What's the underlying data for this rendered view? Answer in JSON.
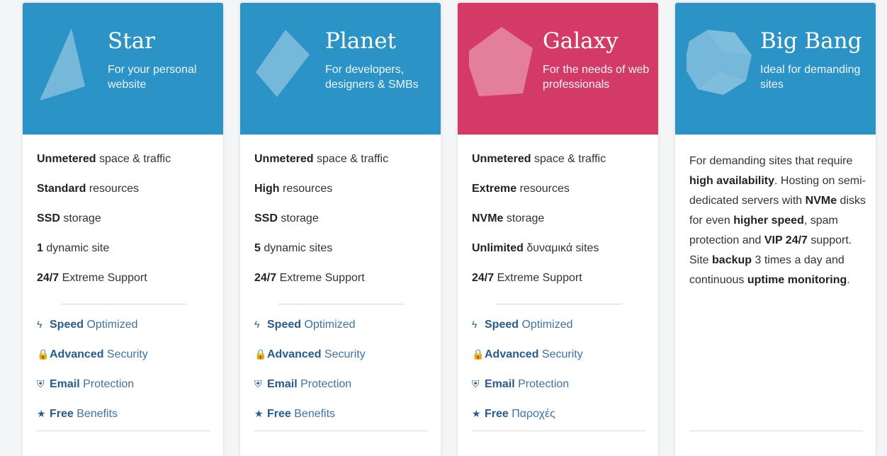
{
  "colors": {
    "blue": "#2c93c6",
    "pink": "#d43a66",
    "link": "#3d72a8"
  },
  "plans": [
    {
      "title": "Star",
      "subtitle": "For your personal website",
      "icon": "triangle-shape-icon",
      "features": [
        {
          "bold": "Unmetered",
          "rest": " space & traffic"
        },
        {
          "bold": "Standard",
          "rest": " resources"
        },
        {
          "bold": "SSD",
          "rest": " storage"
        },
        {
          "bold": "1",
          "rest": " dynamic site"
        },
        {
          "bold": "24/7",
          "rest": " Extreme Support"
        }
      ],
      "benefits": [
        {
          "icon": "ϟ",
          "bold": "Speed",
          "rest": " Optimized"
        },
        {
          "icon": "🔒",
          "bold": "Advanced",
          "rest": " Security"
        },
        {
          "icon": "⛨",
          "bold": "Email",
          "rest": " Protection"
        },
        {
          "icon": "★",
          "bold": "Free",
          "rest": " Benefits"
        }
      ]
    },
    {
      "title": "Planet",
      "subtitle": "For developers, designers & SMBs",
      "icon": "diamond-shape-icon",
      "features": [
        {
          "bold": "Unmetered",
          "rest": " space & traffic"
        },
        {
          "bold": "High",
          "rest": " resources"
        },
        {
          "bold": "SSD",
          "rest": " storage"
        },
        {
          "bold": "5",
          "rest": " dynamic sites"
        },
        {
          "bold": "24/7",
          "rest": " Extreme Support"
        }
      ],
      "benefits": [
        {
          "icon": "ϟ",
          "bold": "Speed",
          "rest": " Optimized"
        },
        {
          "icon": "🔒",
          "bold": "Advanced",
          "rest": " Security"
        },
        {
          "icon": "⛨",
          "bold": "Email",
          "rest": " Protection"
        },
        {
          "icon": "★",
          "bold": "Free",
          "rest": " Benefits"
        }
      ]
    },
    {
      "title": "Galaxy",
      "subtitle": "For the needs of web professionals",
      "icon": "pentagon-shape-icon",
      "features": [
        {
          "bold": "Unmetered",
          "rest": " space & traffic"
        },
        {
          "bold": "Extreme",
          "rest": " resources"
        },
        {
          "bold": "NVMe",
          "rest": " storage"
        },
        {
          "bold": "Unlimited",
          "rest": " δυναμικά sites"
        },
        {
          "bold": "24/7",
          "rest": " Extreme Support"
        }
      ],
      "benefits": [
        {
          "icon": "ϟ",
          "bold": "Speed",
          "rest": " Optimized"
        },
        {
          "icon": "🔒",
          "bold": "Advanced",
          "rest": " Security"
        },
        {
          "icon": "⛨",
          "bold": "Email",
          "rest": " Protection"
        },
        {
          "icon": "★",
          "bold": "Free",
          "rest": " Παροχές"
        }
      ]
    },
    {
      "title": "Big Bang",
      "subtitle": "Ideal for demanding sites",
      "icon": "polyhedron-shape-icon",
      "description": [
        {
          "t": "For demanding sites that require ",
          "b": false
        },
        {
          "t": "high availability",
          "b": true
        },
        {
          "t": ". Hosting on semi-dedicated servers with ",
          "b": false
        },
        {
          "t": "NVMe",
          "b": true
        },
        {
          "t": " disks for even ",
          "b": false
        },
        {
          "t": "higher speed",
          "b": true
        },
        {
          "t": ", spam protection and ",
          "b": false
        },
        {
          "t": "VIP 24/7",
          "b": true
        },
        {
          "t": " support. Site ",
          "b": false
        },
        {
          "t": "backup",
          "b": true
        },
        {
          "t": " 3 times a day and continuous ",
          "b": false
        },
        {
          "t": "uptime monitoring",
          "b": true
        },
        {
          "t": ".",
          "b": false
        }
      ]
    }
  ]
}
